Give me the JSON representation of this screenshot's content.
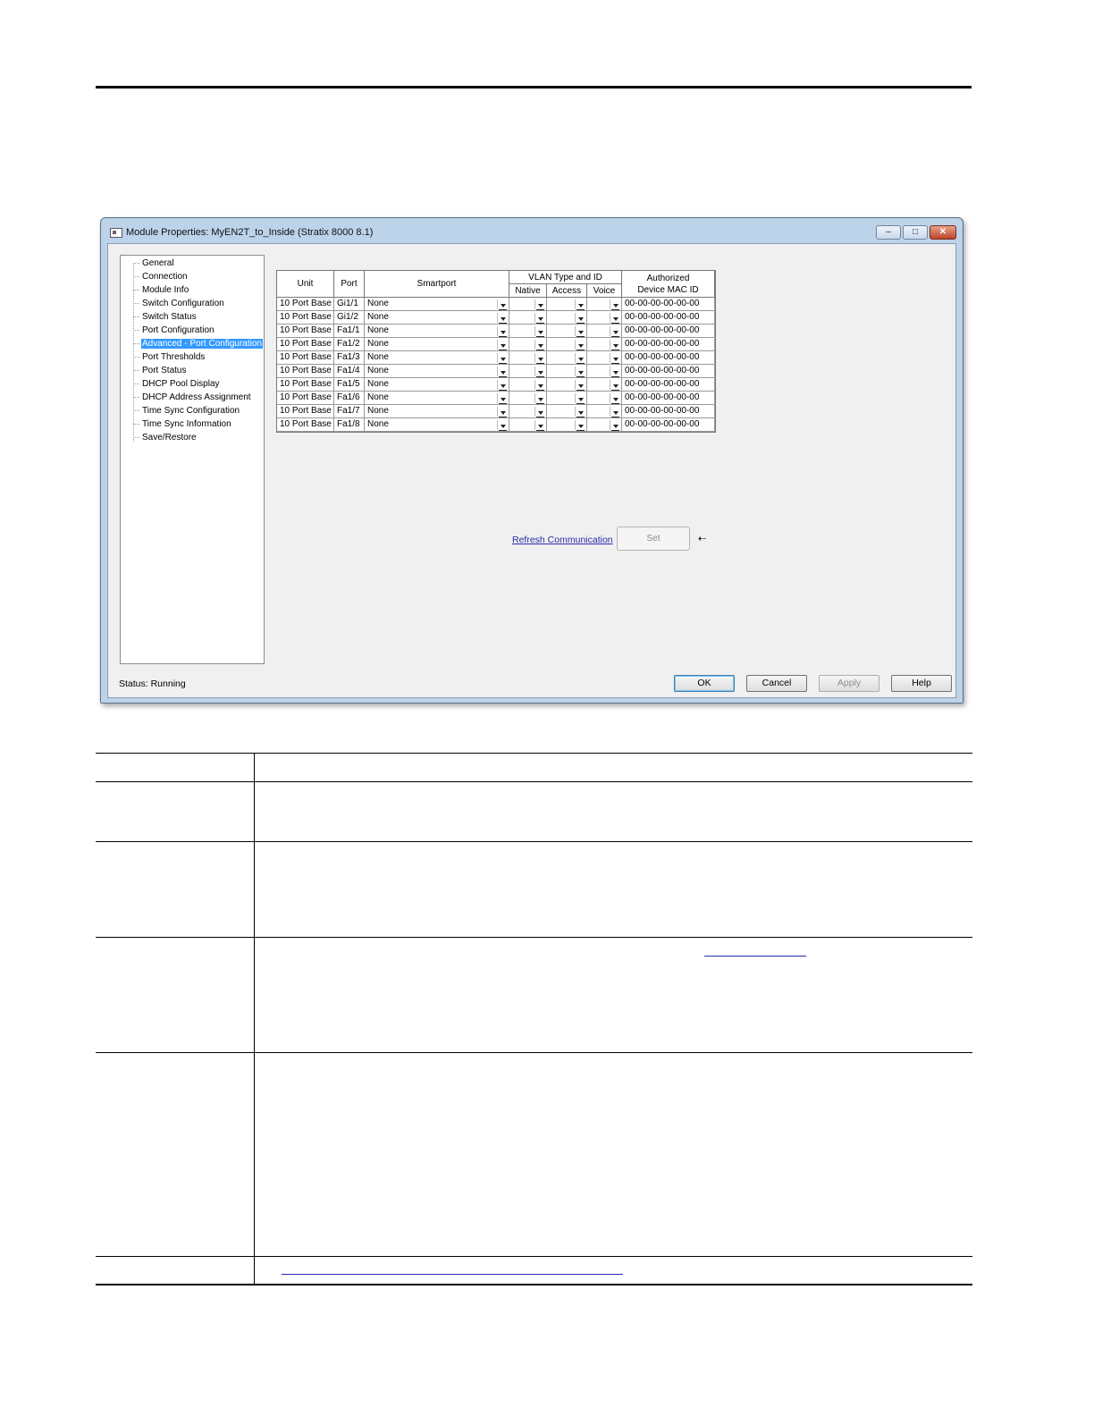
{
  "window": {
    "title": "Module Properties: MyEN2T_to_Inside (Stratix 8000 8.1)",
    "buttons": {
      "minimize": "–",
      "maximize": "□",
      "close": "✕"
    }
  },
  "tree": {
    "items": [
      {
        "label": "General"
      },
      {
        "label": "Connection"
      },
      {
        "label": "Module Info"
      },
      {
        "label": "Switch Configuration"
      },
      {
        "label": "Switch Status"
      },
      {
        "label": "Port Configuration"
      },
      {
        "label": "Advanced - Port Configuration",
        "selected": true
      },
      {
        "label": "Port Thresholds"
      },
      {
        "label": "Port Status"
      },
      {
        "label": "DHCP Pool Display"
      },
      {
        "label": "DHCP Address Assignment"
      },
      {
        "label": "Time Sync Configuration"
      },
      {
        "label": "Time Sync Information"
      },
      {
        "label": "Save/Restore"
      }
    ]
  },
  "grid": {
    "headers": {
      "unit": "Unit",
      "port": "Port",
      "smartport": "Smartport",
      "vlan_group": "VLAN Type and ID",
      "native": "Native",
      "access": "Access",
      "voice": "Voice",
      "mac_line1": "Authorized",
      "mac_line2": "Device MAC ID"
    },
    "rows": [
      {
        "unit": "10 Port Base",
        "port": "Gi1/1",
        "smartport": "None",
        "mac": "00-00-00-00-00-00"
      },
      {
        "unit": "10 Port Base",
        "port": "Gi1/2",
        "smartport": "None",
        "mac": "00-00-00-00-00-00"
      },
      {
        "unit": "10 Port Base",
        "port": "Fa1/1",
        "smartport": "None",
        "mac": "00-00-00-00-00-00"
      },
      {
        "unit": "10 Port Base",
        "port": "Fa1/2",
        "smartport": "None",
        "mac": "00-00-00-00-00-00"
      },
      {
        "unit": "10 Port Base",
        "port": "Fa1/3",
        "smartport": "None",
        "mac": "00-00-00-00-00-00"
      },
      {
        "unit": "10 Port Base",
        "port": "Fa1/4",
        "smartport": "None",
        "mac": "00-00-00-00-00-00"
      },
      {
        "unit": "10 Port Base",
        "port": "Fa1/5",
        "smartport": "None",
        "mac": "00-00-00-00-00-00"
      },
      {
        "unit": "10 Port Base",
        "port": "Fa1/6",
        "smartport": "None",
        "mac": "00-00-00-00-00-00"
      },
      {
        "unit": "10 Port Base",
        "port": "Fa1/7",
        "smartport": "None",
        "mac": "00-00-00-00-00-00"
      },
      {
        "unit": "10 Port Base",
        "port": "Fa1/8",
        "smartport": "None",
        "mac": "00-00-00-00-00-00"
      }
    ]
  },
  "actions": {
    "refresh_link": "Refresh Communication",
    "set_button": "Set",
    "arrow": "⇠"
  },
  "footer": {
    "status": "Status:  Running",
    "ok": "OK",
    "cancel": "Cancel",
    "apply": "Apply",
    "help": "Help"
  },
  "colors": {
    "selection": "#3399ff",
    "link": "#2a2aa8",
    "window_frame": "#bcd3ea"
  }
}
